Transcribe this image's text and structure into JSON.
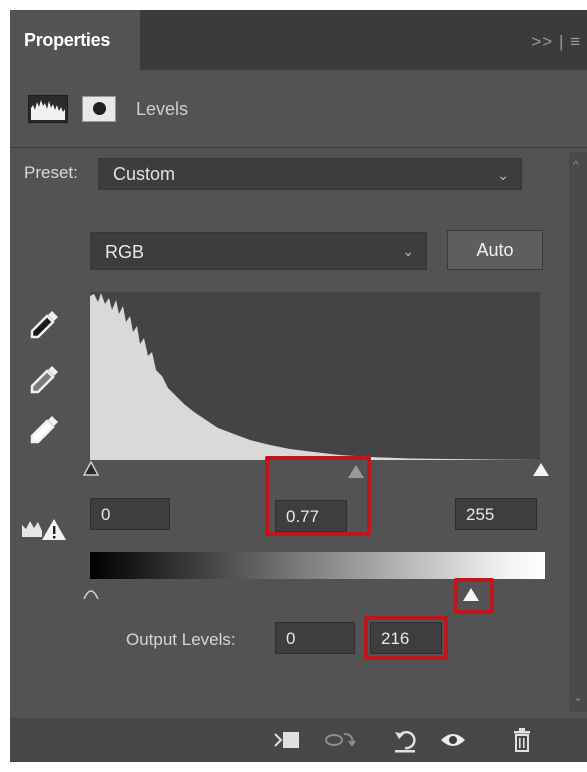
{
  "panel": {
    "tab_label": "Properties",
    "tab_controls": ">> | ≡"
  },
  "header": {
    "title": "Levels",
    "icons": [
      "levels-histogram-icon",
      "layer-mask-icon"
    ]
  },
  "preset": {
    "label": "Preset:",
    "value": "Custom"
  },
  "channel": {
    "value": "RGB",
    "auto_label": "Auto"
  },
  "tools": {
    "eyedroppers": [
      "black-point-eyedropper-icon",
      "gray-point-eyedropper-icon",
      "white-point-eyedropper-icon"
    ],
    "clipping_warning": "clipping-warning-icon"
  },
  "input_levels": {
    "shadow": "0",
    "midtone": "0.77",
    "highlight": "255"
  },
  "output_levels": {
    "label": "Output Levels:",
    "black": "0",
    "white": "216"
  },
  "bottom_toolbar": [
    "clip-to-layer-icon",
    "view-previous-state-icon",
    "reset-icon",
    "visibility-eye-icon",
    "trash-icon"
  ],
  "colors": {
    "panel_bg": "#535353",
    "tab_bar_bg": "#3b3b3b",
    "field_bg": "#3e3e3e",
    "histogram_bg": "#444444",
    "histogram_fill": "#d9d9d9",
    "highlight_box": "#c0151b"
  }
}
